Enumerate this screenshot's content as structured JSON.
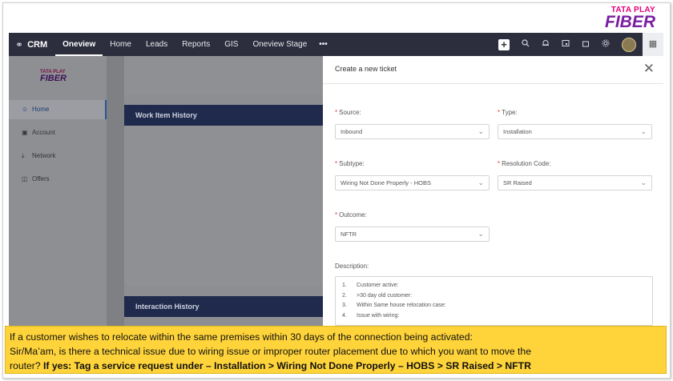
{
  "brand": {
    "line1": "TATA PLAY",
    "line2": "FIBER"
  },
  "topbar": {
    "app_name": "CRM",
    "nav": [
      "Oneview",
      "Home",
      "Leads",
      "Reports",
      "GIS",
      "Oneview Stage"
    ],
    "more": "•••",
    "icons": [
      "plus-icon",
      "search-icon",
      "bell-icon",
      "calendar-icon",
      "store-icon",
      "gear-icon",
      "avatar",
      "apps-grid-icon"
    ]
  },
  "sidebar": {
    "logo_line1": "TATA PLAY",
    "logo_line2": "FIBER",
    "items": [
      {
        "label": "Home",
        "icon": "person-icon",
        "active": true
      },
      {
        "label": "Account",
        "icon": "account-icon",
        "active": false
      },
      {
        "label": "Network",
        "icon": "download-icon",
        "active": false
      },
      {
        "label": "Offers",
        "icon": "gift-icon",
        "active": false
      }
    ]
  },
  "main": {
    "work_item_history": "Work Item History",
    "interaction_history": "Interaction History"
  },
  "modal": {
    "title": "Create a new ticket",
    "close": "✕",
    "source_label": "Source:",
    "source_value": "Inbound",
    "type_label": "Type:",
    "type_value": "Installation",
    "subtype_label": "Subtype:",
    "subtype_value": "Wiring Not Done Properly - HOBS",
    "resolution_label": "Resolution Code:",
    "resolution_value": "SR Raised",
    "outcome_label": "Outcome:",
    "outcome_value": "NFTR",
    "description_label": "Description:",
    "description_items": [
      {
        "n": "1.",
        "text": "Customer active:"
      },
      {
        "n": "2.",
        "text": ">30 day old customer:"
      },
      {
        "n": "3.",
        "text": "Within Same house relocation case:"
      },
      {
        "n": "4.",
        "text": "Issue with wiring:"
      }
    ]
  },
  "note": {
    "line1": "If a customer wishes to relocate within the same premises within 30 days of the connection being activated:",
    "line2": " Sir/Ma’am, is there a technical issue due to wiring issue or improper router placement due to which you want to move the",
    "line3_plain": "router? ",
    "line3_bold": "If yes: Tag a service request under – Installation > Wiring Not Done Properly – HOBS > SR Raised > NFTR"
  }
}
